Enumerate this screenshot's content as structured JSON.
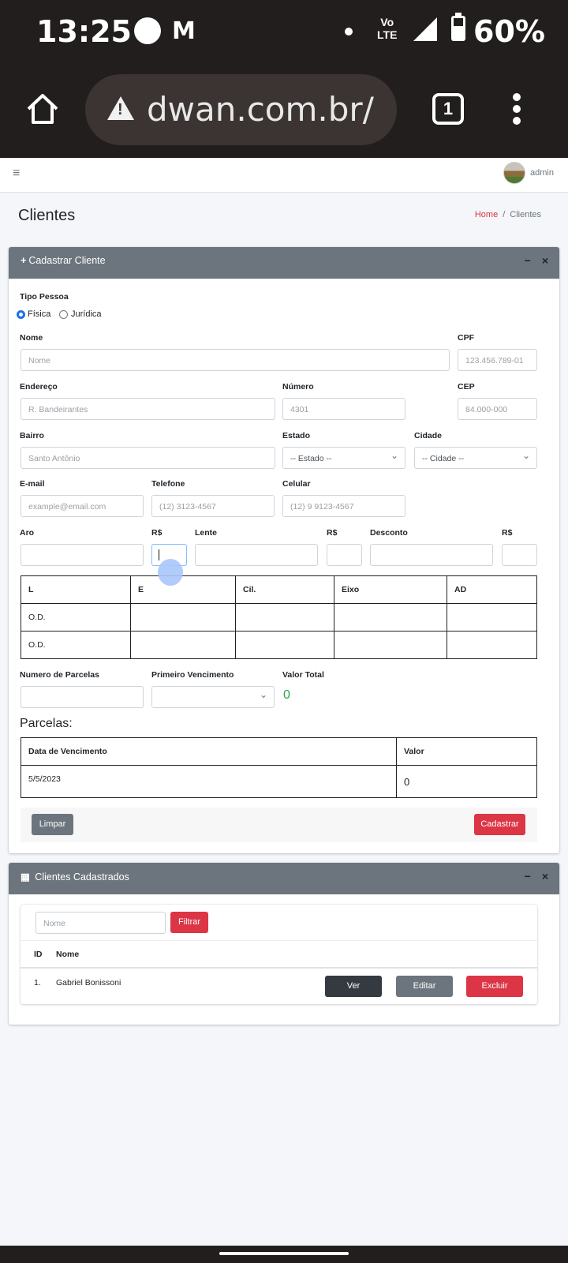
{
  "status_bar": {
    "time": "13:25",
    "gmail": "M",
    "network": "Vo\nLTE",
    "battery": "60%"
  },
  "browser": {
    "url": "dwan.com.br/",
    "tab_count": "1"
  },
  "topnav": {
    "hamburger": "≡",
    "username": "admin"
  },
  "page": {
    "title": "Clientes",
    "breadcrumb_home": "Home",
    "breadcrumb_sep": "/",
    "breadcrumb_current": "Clientes"
  },
  "form_card": {
    "title": "Cadastrar Cliente",
    "icon": "+",
    "tools": {
      "collapse": "−",
      "close": "×"
    },
    "tipo_pessoa": {
      "label": "Tipo Pessoa",
      "options": [
        "Física",
        "Jurídica"
      ],
      "selected": "Física"
    },
    "nome": {
      "label": "Nome",
      "placeholder": "Nome"
    },
    "cpf": {
      "label": "CPF",
      "placeholder": "123.456.789-01"
    },
    "endereco": {
      "label": "Endereço",
      "placeholder": "R. Bandeirantes"
    },
    "numero": {
      "label": "Número",
      "placeholder": "4301"
    },
    "cep": {
      "label": "CEP",
      "placeholder": "84.000-000"
    },
    "bairro": {
      "label": "Bairro",
      "placeholder": "Santo Antônio"
    },
    "estado": {
      "label": "Estado",
      "value": "-- Estado --"
    },
    "cidade": {
      "label": "Cidade",
      "value": "-- Cidade --"
    },
    "email": {
      "label": "E-mail",
      "placeholder": "example@email.com"
    },
    "telefone": {
      "label": "Telefone",
      "placeholder": "(12) 3123-4567"
    },
    "celular": {
      "label": "Celular",
      "placeholder": "(12) 9 9123-4567"
    },
    "aro": {
      "label": "Aro"
    },
    "rs1": {
      "label": "R$"
    },
    "lente": {
      "label": "Lente"
    },
    "rs2": {
      "label": "R$"
    },
    "desconto": {
      "label": "Desconto"
    },
    "rs3": {
      "label": "R$"
    },
    "grau_table": {
      "headers": [
        "L",
        "E",
        "Cil.",
        "Eixo",
        "AD"
      ],
      "rows": [
        [
          "O.D.",
          "",
          "",
          "",
          ""
        ],
        [
          "O.D.",
          "",
          "",
          "",
          ""
        ]
      ]
    },
    "parcelas_num": {
      "label": "Numero de Parcelas"
    },
    "primeiro_venc": {
      "label": "Primeiro Vencimento"
    },
    "valor_total": {
      "label": "Valor Total",
      "value": "0"
    },
    "parcelas_heading": "Parcelas:",
    "parcelas_table": {
      "headers": [
        "Data de Vencimento",
        "Valor"
      ],
      "rows": [
        [
          "5/5/2023",
          "0"
        ]
      ]
    },
    "btn_limpar": "Limpar",
    "btn_cadastrar": "Cadastrar"
  },
  "list_card": {
    "title": "Clientes Cadastrados",
    "icon": "▦",
    "tools": {
      "collapse": "−",
      "close": "×"
    },
    "filter_placeholder": "Nome",
    "btn_filtrar": "Filtrar",
    "headers": [
      "ID",
      "Nome"
    ],
    "rows": [
      {
        "id": "1.",
        "nome": "Gabriel Bonissoni"
      }
    ],
    "btn_ver": "Ver",
    "btn_editar": "Editar",
    "btn_excluir": "Excluir"
  }
}
